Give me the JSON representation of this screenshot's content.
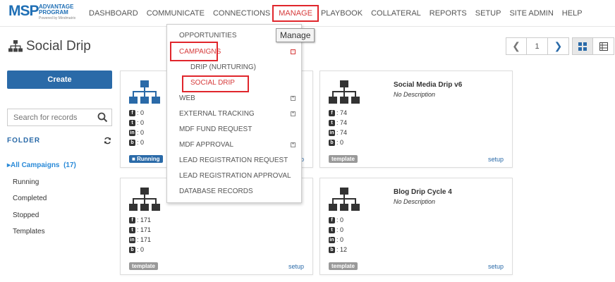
{
  "logo": {
    "msp": "MSP",
    "line1": "ADVANTAGE",
    "line2": "PROGRAM",
    "powered": "Powered by Mindmatrix"
  },
  "nav": [
    "DASHBOARD",
    "COMMUNICATE",
    "CONNECTIONS",
    "MANAGE",
    "PLAYBOOK",
    "COLLATERAL",
    "REPORTS",
    "SETUP",
    "SITE ADMIN",
    "HELP"
  ],
  "tooltip": "Manage",
  "page": {
    "title": "Social Drip"
  },
  "pager": {
    "prev": "❮",
    "page": "1",
    "next": "❯"
  },
  "sidebar": {
    "create_label": "Create",
    "search_placeholder": "Search for records",
    "folder_label": "FOLDER",
    "items": [
      {
        "label": "All Campaigns",
        "count": "(17)"
      },
      {
        "label": "Running"
      },
      {
        "label": "Completed"
      },
      {
        "label": "Stopped"
      },
      {
        "label": "Templates"
      }
    ]
  },
  "cards": [
    {
      "title": "",
      "desc": "",
      "stats": [
        "0",
        "0",
        "0",
        "0"
      ],
      "badge": "Running",
      "setup": "setup"
    },
    {
      "title": "Social Media Drip v6",
      "desc": "No Description",
      "stats": [
        "74",
        "74",
        "74",
        "0"
      ],
      "badge": "template",
      "setup": "setup"
    },
    {
      "title": "",
      "desc": "",
      "stats": [
        "171",
        "171",
        "171",
        "0"
      ],
      "badge": "template",
      "setup": "setup"
    },
    {
      "title": "Blog Drip Cycle 4",
      "desc": "No Description",
      "stats": [
        "0",
        "0",
        "0",
        "12"
      ],
      "badge": "template",
      "setup": "setup"
    }
  ],
  "dropdown": {
    "items": [
      {
        "label": "OPPORTUNITIES"
      },
      {
        "label": "CAMPAIGNS"
      },
      {
        "label": "DRIP (NURTURING)"
      },
      {
        "label": "SOCIAL DRIP"
      },
      {
        "label": "WEB"
      },
      {
        "label": "EXTERNAL TRACKING"
      },
      {
        "label": "MDF FUND REQUEST"
      },
      {
        "label": "MDF APPROVAL"
      },
      {
        "label": "LEAD REGISTRATION REQUEST"
      },
      {
        "label": "LEAD REGISTRATION APPROVAL"
      },
      {
        "label": "DATABASE RECORDS"
      }
    ],
    "expand_plus": "+",
    "collapse_minus": "−"
  },
  "icons": {
    "stat_icons": [
      "f",
      "t",
      "in",
      "b"
    ],
    "stat_separator": ":",
    "running_mark": "■"
  },
  "colors": {
    "brand": "#1f6fb5",
    "accent_red": "#e0262c",
    "link": "#2a6aa8"
  }
}
